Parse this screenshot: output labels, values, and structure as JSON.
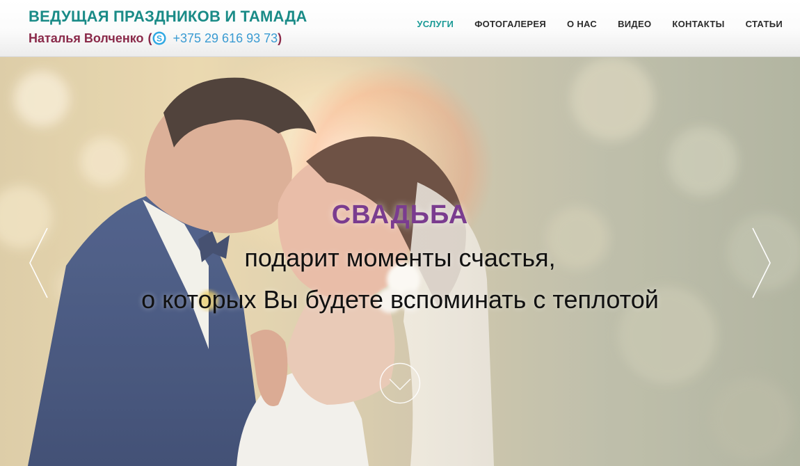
{
  "header": {
    "title": "ВЕДУЩАЯ ПРАЗДНИКОВ И ТАМАДА",
    "name": "Наталья Волченко",
    "open_paren": "(",
    "close_paren": ")",
    "phone": "+375 29 616 93 73"
  },
  "nav": {
    "items": [
      {
        "label": "УСЛУГИ",
        "active": true
      },
      {
        "label": "ФОТОГАЛЕРЕЯ"
      },
      {
        "label": "О НАС"
      },
      {
        "label": "ВИДЕО"
      },
      {
        "label": "КОНТАКТЫ"
      },
      {
        "label": "СТАТЬИ"
      }
    ]
  },
  "hero": {
    "title": "СВАДЬБА",
    "line1": "подарит моменты счастья,",
    "line2": "о которых Вы будете вспоминать с теплотой",
    "image": "wedding-couple-kiss-photo"
  },
  "icons": {
    "contact": "skype-icon",
    "prev": "chevron-left-icon",
    "next": "chevron-right-icon",
    "scroll": "chevron-down-circle-icon"
  },
  "colors": {
    "brand_teal": "#1a8b87",
    "name_maroon": "#8a2a4a",
    "phone_blue": "#3a9bd2",
    "nav_active": "#1a9a96",
    "hero_title_purple": "#7a3c8f"
  }
}
